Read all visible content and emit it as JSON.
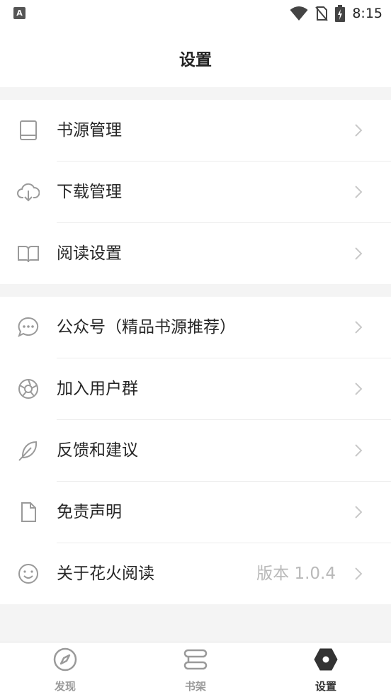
{
  "status_bar": {
    "left_icon_letter": "A",
    "icons": [
      "wifi-icon",
      "no-sim-icon",
      "battery-charging-icon"
    ],
    "time": "8:15"
  },
  "header": {
    "title": "设置"
  },
  "groups": [
    {
      "items": [
        {
          "label": "书源管理",
          "icon": "book-icon"
        },
        {
          "label": "下载管理",
          "icon": "cloud-download-icon"
        },
        {
          "label": "阅读设置",
          "icon": "open-book-icon"
        }
      ]
    },
    {
      "items": [
        {
          "label": "公众号（精品书源推荐）",
          "icon": "chat-bubble-icon"
        },
        {
          "label": "加入用户群",
          "icon": "aperture-icon"
        },
        {
          "label": "反馈和建议",
          "icon": "feather-icon"
        },
        {
          "label": "免责声明",
          "icon": "document-icon"
        },
        {
          "label": "关于花火阅读",
          "icon": "smiley-icon",
          "value": "版本 1.0.4"
        }
      ]
    }
  ],
  "tabbar": {
    "tabs": [
      {
        "label": "发现",
        "icon": "compass-icon",
        "active": false
      },
      {
        "label": "书架",
        "icon": "bookshelf-icon",
        "active": false
      },
      {
        "label": "设置",
        "icon": "hexagon-settings-icon",
        "active": true
      }
    ]
  },
  "colors": {
    "background": "#f4f4f4",
    "text": "#262626",
    "muted": "#b9b9b9",
    "icon": "#9a9a9a"
  }
}
